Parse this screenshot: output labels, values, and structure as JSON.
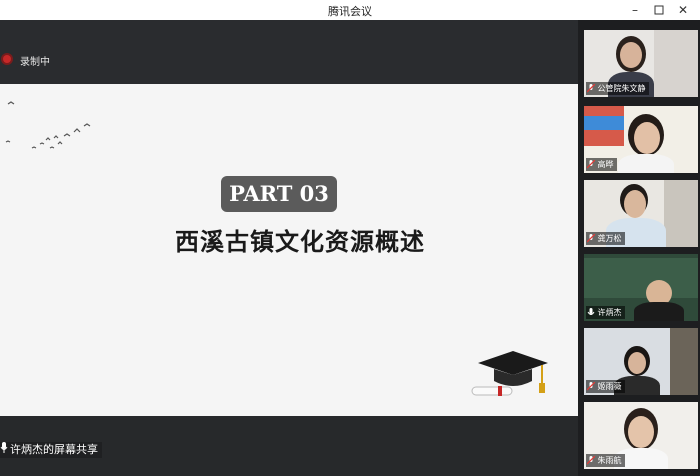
{
  "window": {
    "title": "腾讯会议"
  },
  "recording": {
    "label": "录制中"
  },
  "slide": {
    "part": "PART 03",
    "title": "西溪古镇文化资源概述"
  },
  "share": {
    "label": "许炳杰的屏幕共享"
  },
  "participants": [
    {
      "name": "公管院朱文静"
    },
    {
      "name": "高晔"
    },
    {
      "name": "龚万松"
    },
    {
      "name": "许炳杰",
      "speaking": true
    },
    {
      "name": "姬雨薇"
    },
    {
      "name": "朱雨航"
    }
  ],
  "colors": {
    "record": "#c62828",
    "speaking": "#3fae5a",
    "badge": "#5b5b5b"
  }
}
